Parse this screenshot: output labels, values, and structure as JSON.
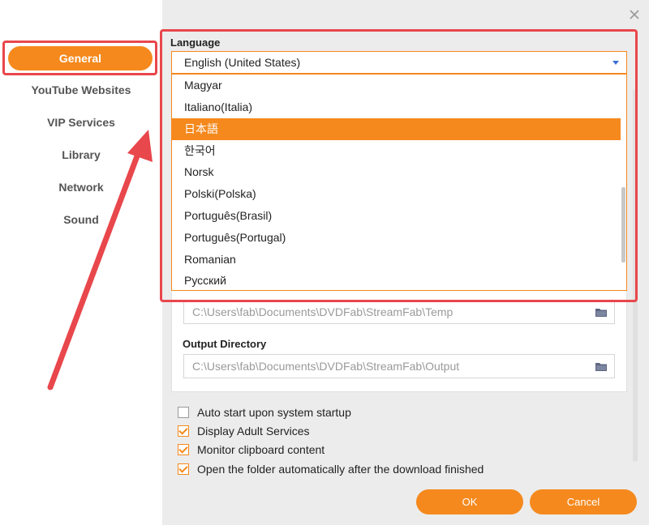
{
  "sidebar": {
    "items": [
      {
        "label": "General"
      },
      {
        "label": "YouTube Websites"
      },
      {
        "label": "VIP Services"
      },
      {
        "label": "Library"
      },
      {
        "label": "Network"
      },
      {
        "label": "Sound"
      }
    ]
  },
  "language": {
    "label": "Language",
    "selected": "English (United States)",
    "options": [
      "Magyar",
      "Italiano(Italia)",
      "日本語",
      "한국어",
      "Norsk",
      "Polski(Polska)",
      "Português(Brasil)",
      "Português(Portugal)",
      "Romanian",
      "Русский"
    ],
    "highlighted": "日本語"
  },
  "temp_dir": {
    "value": "C:\\Users\\fab\\Documents\\DVDFab\\StreamFab\\Temp"
  },
  "output_dir": {
    "label": "Output Directory",
    "value": "C:\\Users\\fab\\Documents\\DVDFab\\StreamFab\\Output"
  },
  "options": [
    {
      "label": "Auto start upon system startup",
      "checked": false
    },
    {
      "label": "Display Adult Services",
      "checked": true
    },
    {
      "label": "Monitor clipboard content",
      "checked": true
    },
    {
      "label": "Open the folder automatically after the download finished",
      "checked": true
    }
  ],
  "buttons": {
    "ok": "OK",
    "cancel": "Cancel"
  },
  "colors": {
    "accent": "#f5891d",
    "annotation": "#e8474c"
  }
}
